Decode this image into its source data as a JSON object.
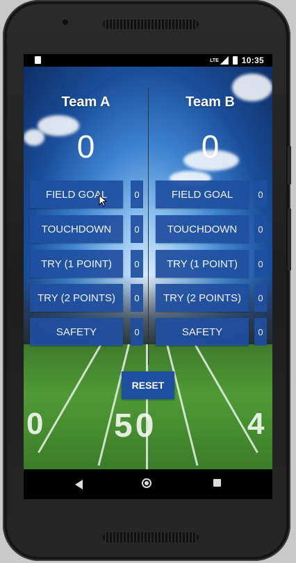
{
  "status_bar": {
    "network": "LTE",
    "time": "10:35"
  },
  "teams": [
    {
      "name": "Team A",
      "score": "0",
      "actions": [
        {
          "label": "FIELD GOAL",
          "count": "0"
        },
        {
          "label": "TOUCHDOWN",
          "count": "0"
        },
        {
          "label": "TRY (1 POINT)",
          "count": "0"
        },
        {
          "label": "TRY (2 POINTS)",
          "count": "0"
        },
        {
          "label": "SAFETY",
          "count": "0"
        }
      ]
    },
    {
      "name": "Team B",
      "score": "0",
      "actions": [
        {
          "label": "FIELD GOAL",
          "count": "0"
        },
        {
          "label": "TOUCHDOWN",
          "count": "0"
        },
        {
          "label": "TRY (1 POINT)",
          "count": "0"
        },
        {
          "label": "TRY (2 POINTS)",
          "count": "0"
        },
        {
          "label": "SAFETY",
          "count": "0"
        }
      ]
    }
  ],
  "reset_label": "RESET",
  "field_markings": [
    "0",
    "50",
    "4"
  ],
  "colors": {
    "button_blue": "#1f4fa0",
    "text": "#ffffff"
  },
  "nav_icons": [
    "back-icon",
    "home-icon",
    "recents-icon"
  ]
}
